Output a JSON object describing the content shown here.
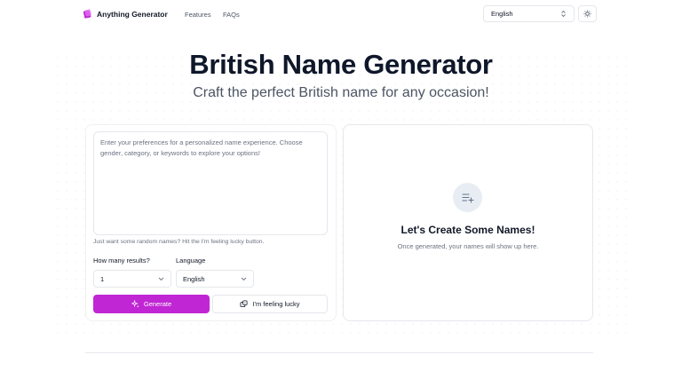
{
  "nav": {
    "brand": "Anything Generator",
    "links": [
      "Features",
      "FAQs"
    ],
    "language": "English",
    "colors": {
      "brand": "#c026d3"
    }
  },
  "hero": {
    "title": "British Name Generator",
    "subtitle": "Craft the perfect British name for any occasion!"
  },
  "form": {
    "placeholder": "Enter your preferences for a personalized name experience. Choose gender, category, or keywords to explore your options!",
    "hint": "Just want some random names? Hit the I'm feeling lucky button.",
    "results_label": "How many results?",
    "results_value": "1",
    "language_label": "Language",
    "language_value": "English",
    "generate_label": "Generate",
    "lucky_label": "I'm feeling lucky",
    "accent": "#c026d3"
  },
  "empty_state": {
    "title": "Let's Create Some Names!",
    "description": "Once generated, your names will show up here.",
    "icon": "list-add-icon"
  }
}
